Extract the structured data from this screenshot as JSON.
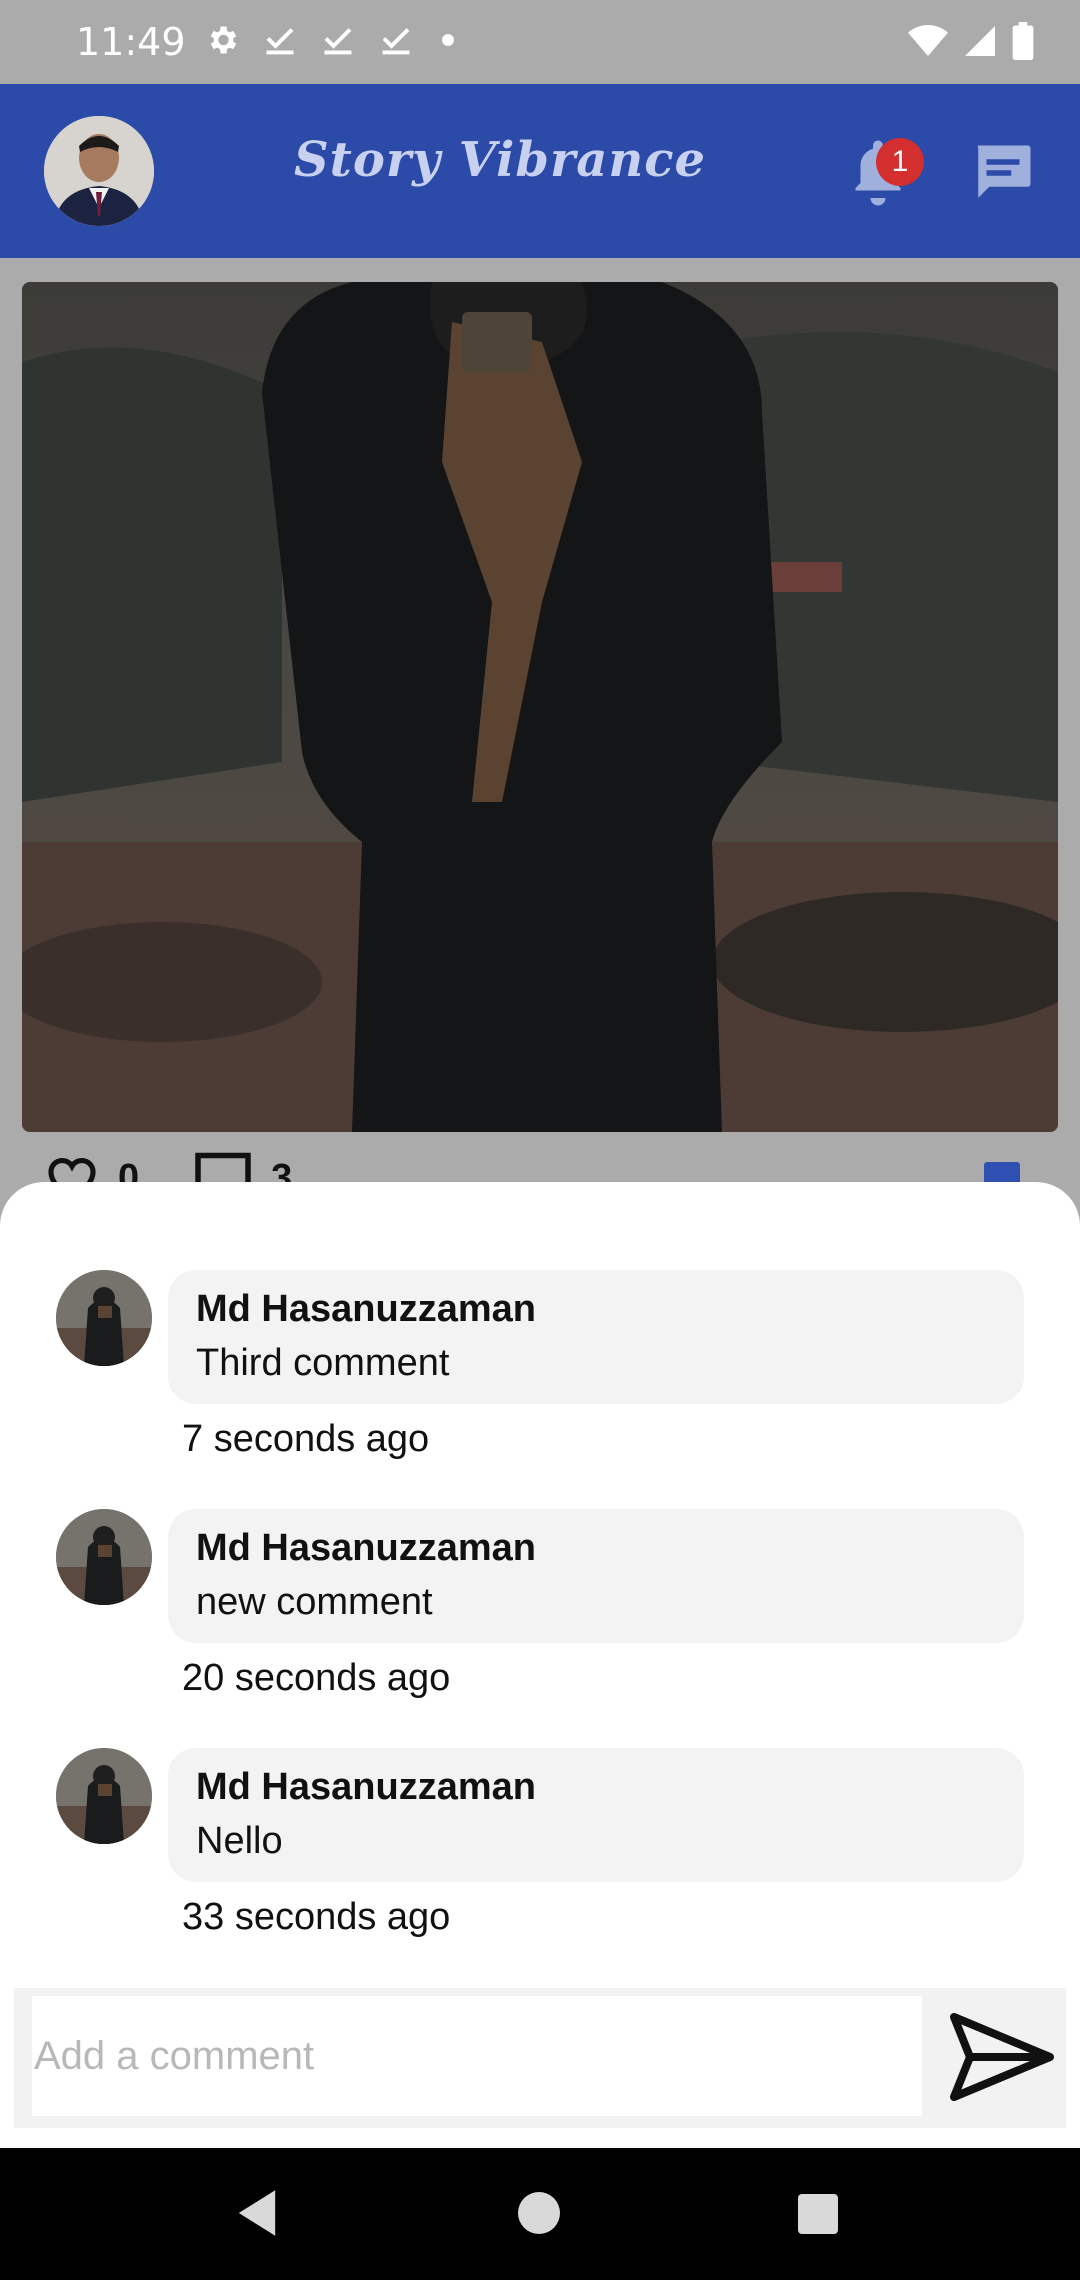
{
  "status_bar": {
    "time": "11:49",
    "icons": [
      "gear-icon",
      "check-download-icon",
      "check-download-icon",
      "check-download-icon",
      "dot-icon",
      "wifi-icon",
      "signal-icon",
      "battery-icon"
    ]
  },
  "app_bar": {
    "title": "Story Vibrance",
    "notification_count": "1",
    "color": "#2f4fb3"
  },
  "post": {
    "like_count": "0",
    "comment_count": "3"
  },
  "comments": [
    {
      "author": "Md Hasanuzzaman",
      "text": "Third comment",
      "time": "7 seconds ago"
    },
    {
      "author": "Md Hasanuzzaman",
      "text": "new comment",
      "time": "20 seconds ago"
    },
    {
      "author": "Md Hasanuzzaman",
      "text": "Nello",
      "time": "33 seconds ago"
    }
  ],
  "composer": {
    "placeholder": "Add a comment"
  },
  "nav": {
    "icons": [
      "back-icon",
      "home-icon",
      "recents-icon"
    ]
  }
}
